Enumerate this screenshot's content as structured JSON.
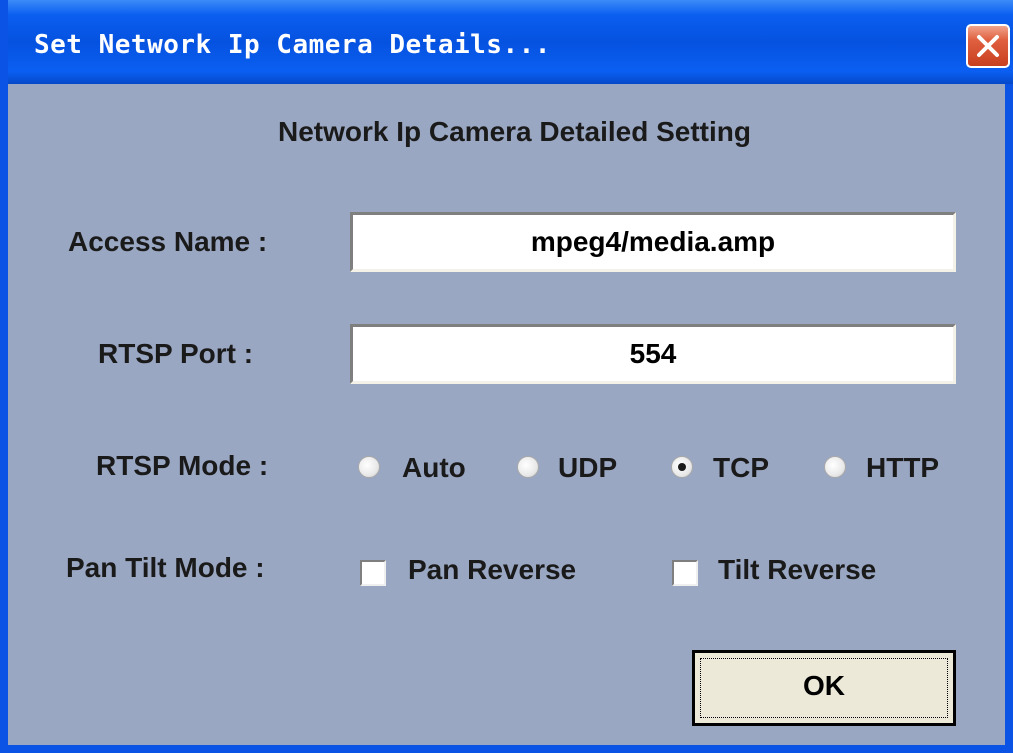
{
  "window": {
    "title": "Set Network Ip Camera Details...",
    "close_icon": "close-icon"
  },
  "dialog": {
    "heading": "Network Ip Camera Detailed Setting",
    "access_name": {
      "label": "Access Name :",
      "value": "mpeg4/media.amp"
    },
    "rtsp_port": {
      "label": "RTSP Port :",
      "value": "554"
    },
    "rtsp_mode": {
      "label": "RTSP Mode :",
      "options": [
        {
          "label": "Auto",
          "selected": false
        },
        {
          "label": "UDP",
          "selected": false
        },
        {
          "label": "TCP",
          "selected": true
        },
        {
          "label": "HTTP",
          "selected": false
        }
      ]
    },
    "pan_tilt_mode": {
      "label": "Pan Tilt Mode :",
      "options": [
        {
          "label": "Pan Reverse",
          "checked": false
        },
        {
          "label": "Tilt Reverse",
          "checked": false
        }
      ]
    },
    "ok_label": "OK"
  },
  "colors": {
    "title_bar": "#0a5ef0",
    "dialog_bg": "#9aa7c3",
    "close_button": "#e06040"
  }
}
